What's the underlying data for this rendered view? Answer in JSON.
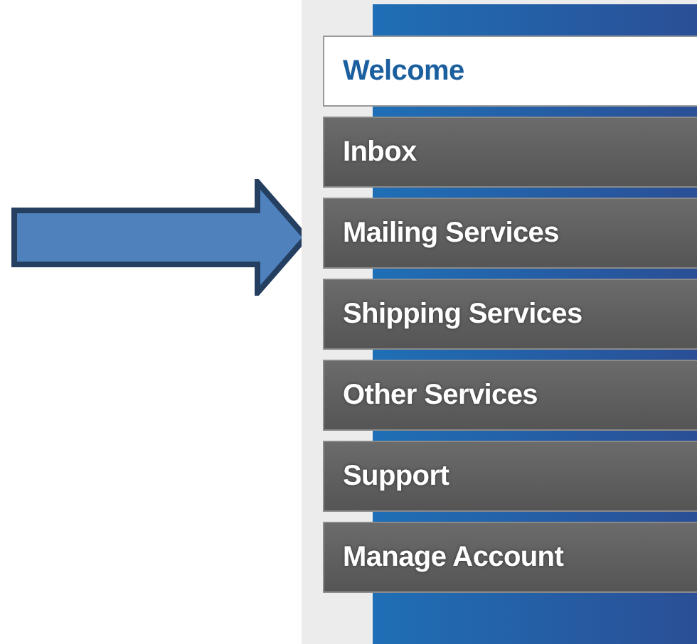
{
  "menu": {
    "items": [
      {
        "label": "Welcome",
        "selected": true
      },
      {
        "label": "Inbox",
        "selected": false
      },
      {
        "label": "Mailing Services",
        "selected": false
      },
      {
        "label": "Shipping Services",
        "selected": false
      },
      {
        "label": "Other Services",
        "selected": false
      },
      {
        "label": "Support",
        "selected": false
      },
      {
        "label": "Manage Account",
        "selected": false
      }
    ]
  }
}
